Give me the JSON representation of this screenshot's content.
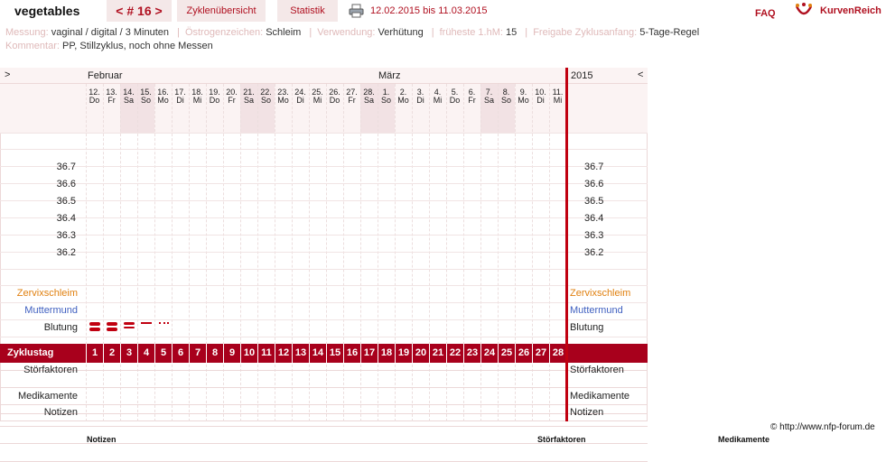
{
  "header": {
    "user": "vegetables",
    "cycle_nav": "< # 16 >",
    "tab_overview": "Zyklenübersicht",
    "tab_stats": "Statistik",
    "date_range": "12.02.2015 bis 11.03.2015",
    "faq": "FAQ",
    "logo_text": "KurvenReich",
    "colors": {
      "accent": "#b01020",
      "tab_bg": "#f4e8e8"
    }
  },
  "meta": {
    "line1": [
      {
        "label": "Messung:",
        "value": "vaginal / digital / 3 Minuten"
      },
      {
        "label": "Östrogenzeichen:",
        "value": "Schleim"
      },
      {
        "label": "Verwendung:",
        "value": "Verhütung"
      },
      {
        "label": "früheste 1.hM:",
        "value": "15"
      },
      {
        "label": "Freigabe Zyklusanfang:",
        "value": "5-Tage-Regel"
      }
    ],
    "line2": {
      "label": "Kommentar:",
      "value": "PP, Stillzyklus, noch ohne Messen"
    }
  },
  "chart": {
    "nav_left": ">",
    "nav_right": "<",
    "month1": "Februar",
    "month2": "März",
    "year": "2015",
    "days": [
      {
        "d": "12.",
        "w": "Do",
        "we": false
      },
      {
        "d": "13.",
        "w": "Fr",
        "we": false
      },
      {
        "d": "14.",
        "w": "Sa",
        "we": true
      },
      {
        "d": "15.",
        "w": "So",
        "we": true
      },
      {
        "d": "16.",
        "w": "Mo",
        "we": false
      },
      {
        "d": "17.",
        "w": "Di",
        "we": false
      },
      {
        "d": "18.",
        "w": "Mi",
        "we": false
      },
      {
        "d": "19.",
        "w": "Do",
        "we": false
      },
      {
        "d": "20.",
        "w": "Fr",
        "we": false
      },
      {
        "d": "21.",
        "w": "Sa",
        "we": true
      },
      {
        "d": "22.",
        "w": "So",
        "we": true
      },
      {
        "d": "23.",
        "w": "Mo",
        "we": false
      },
      {
        "d": "24.",
        "w": "Di",
        "we": false
      },
      {
        "d": "25.",
        "w": "Mi",
        "we": false
      },
      {
        "d": "26.",
        "w": "Do",
        "we": false
      },
      {
        "d": "27.",
        "w": "Fr",
        "we": false
      },
      {
        "d": "28.",
        "w": "Sa",
        "we": true
      },
      {
        "d": "1.",
        "w": "So",
        "we": true
      },
      {
        "d": "2.",
        "w": "Mo",
        "we": false
      },
      {
        "d": "3.",
        "w": "Di",
        "we": false
      },
      {
        "d": "4.",
        "w": "Mi",
        "we": false
      },
      {
        "d": "5.",
        "w": "Do",
        "we": false
      },
      {
        "d": "6.",
        "w": "Fr",
        "we": false
      },
      {
        "d": "7.",
        "w": "Sa",
        "we": true
      },
      {
        "d": "8.",
        "w": "So",
        "we": true
      },
      {
        "d": "9.",
        "w": "Mo",
        "we": false
      },
      {
        "d": "10.",
        "w": "Di",
        "we": false
      },
      {
        "d": "11.",
        "w": "Mi",
        "we": false
      }
    ],
    "temps": [
      "36.7",
      "36.6",
      "36.5",
      "36.4",
      "36.3",
      "36.2"
    ],
    "rows": {
      "cervix": "Zervixschleim",
      "mm": "Muttermund",
      "bleed": "Blutung",
      "cycleday": "Zyklustag",
      "stoer": "Störfaktoren",
      "medi": "Medikamente",
      "notes": "Notizen"
    },
    "bleeding": [
      "heavy",
      "heavy",
      "medium",
      "light",
      "spotting",
      "",
      "",
      "",
      "",
      "",
      "",
      "",
      "",
      "",
      "",
      "",
      "",
      "",
      "",
      "",
      "",
      "",
      "",
      "",
      "",
      "",
      "",
      ""
    ],
    "cycle_days": [
      "1",
      "2",
      "3",
      "4",
      "5",
      "6",
      "7",
      "8",
      "9",
      "10",
      "11",
      "12",
      "13",
      "14",
      "15",
      "16",
      "17",
      "18",
      "19",
      "20",
      "21",
      "22",
      "23",
      "24",
      "25",
      "26",
      "27",
      "28"
    ],
    "colors": {
      "cervix": "#e08010",
      "mm": "#4060c0",
      "cycle_bar": "#a8001c",
      "weekend": "#f2e2e4",
      "line": "#c00010"
    }
  },
  "footer": {
    "copyright": "© http://www.nfp-forum.de",
    "cut1": "Notizen",
    "cut2": "Störfaktoren",
    "cut3": "Medikamente"
  }
}
